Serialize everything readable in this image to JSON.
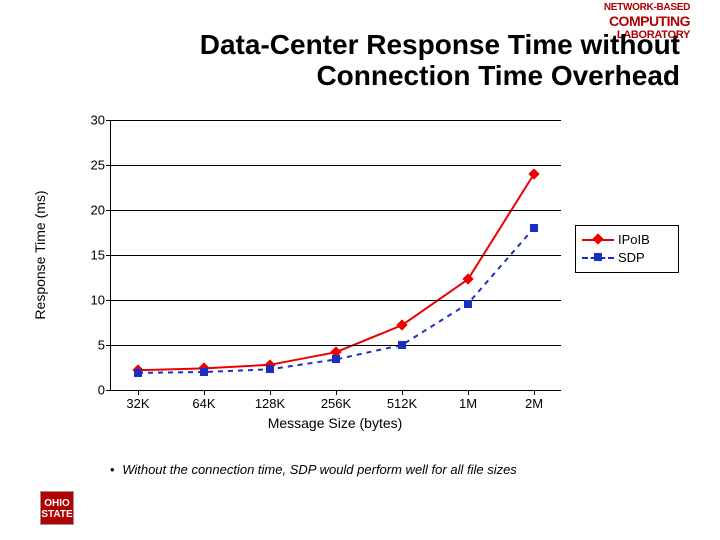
{
  "header_logo": {
    "line1": "NETWORK-BASED",
    "line2": "COMPUTING",
    "line3": "LABORATORY"
  },
  "title_line1": "Data-Center Response Time without",
  "title_line2": "Connection Time Overhead",
  "chart_data": {
    "type": "line",
    "title": "",
    "xlabel": "Message Size (bytes)",
    "ylabel": "Response Time (ms)",
    "categories": [
      "32K",
      "64K",
      "128K",
      "256K",
      "512K",
      "1M",
      "2M"
    ],
    "ylim": [
      0,
      30
    ],
    "yticks": [
      0,
      5,
      10,
      15,
      20,
      25,
      30
    ],
    "series": [
      {
        "name": "IPoIB",
        "values": [
          2.2,
          2.4,
          2.8,
          4.2,
          7.2,
          12.3,
          24.0
        ],
        "color": "#ed0000",
        "marker": "diamond",
        "line": "solid"
      },
      {
        "name": "SDP",
        "values": [
          1.9,
          2.0,
          2.3,
          3.4,
          5.0,
          9.6,
          18.0
        ],
        "color": "#1a2fbf",
        "marker": "square",
        "line": "dashed"
      }
    ]
  },
  "footnote": "Without the connection time, SDP would perform well for all file sizes",
  "osu_logo": {
    "line1": "OHIO",
    "line2": "STATE"
  }
}
